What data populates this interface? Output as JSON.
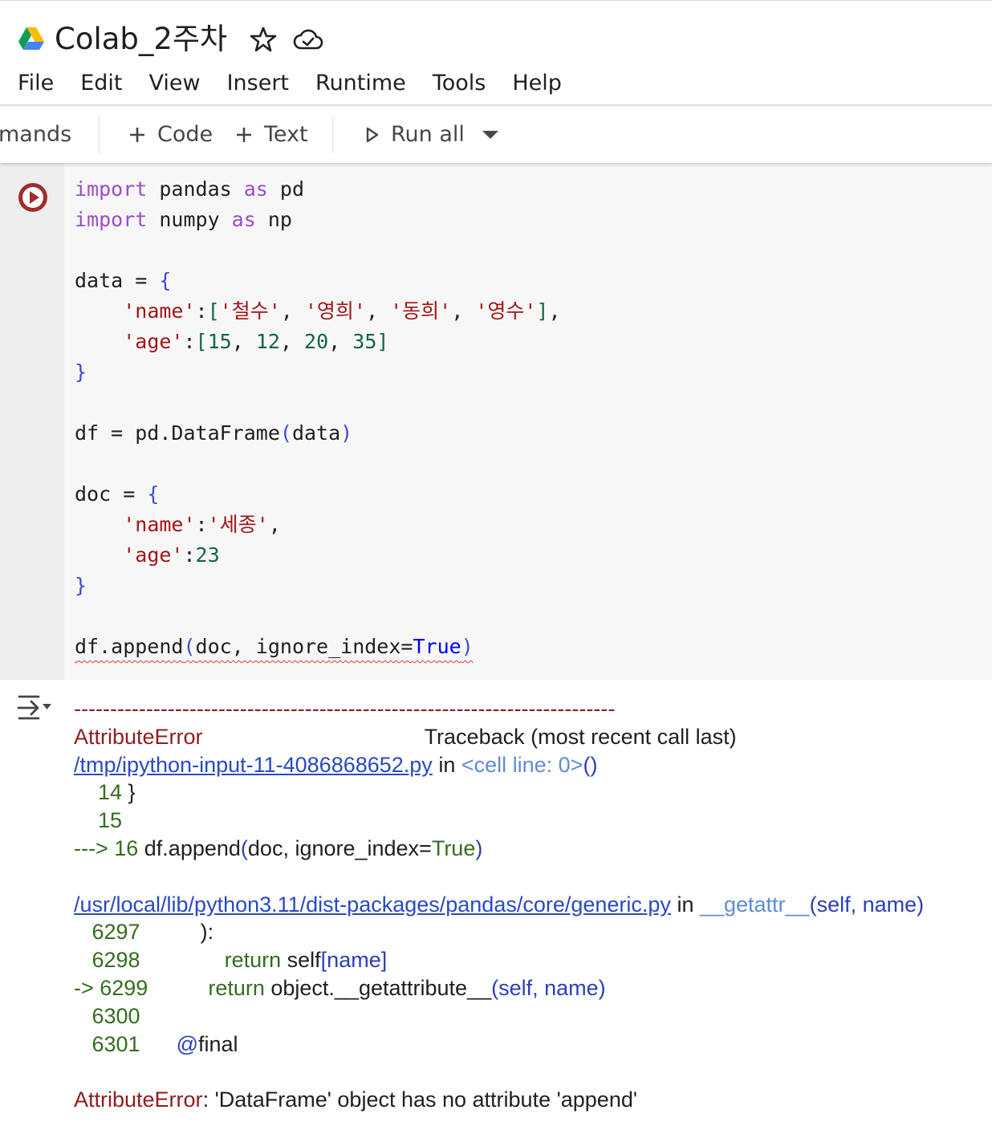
{
  "header": {
    "title": "Colab_2주차",
    "menu": [
      "File",
      "Edit",
      "View",
      "Insert",
      "Runtime",
      "Tools",
      "Help"
    ]
  },
  "toolbar": {
    "commands_label": "mands",
    "code_label": "Code",
    "text_label": "Text",
    "run_all_label": "Run all"
  },
  "cell": {
    "code": {
      "l1_kw1": "import",
      "l1_mod": " pandas ",
      "l1_kw2": "as",
      "l1_alias": " pd",
      "l2_kw1": "import",
      "l2_mod": " numpy ",
      "l2_kw2": "as",
      "l2_alias": " np",
      "l4_a": "data = ",
      "open": "{",
      "close": "}",
      "l5_indent": "    ",
      "name_key": "'name'",
      "colon": ":",
      "lbr": "[",
      "s1": "'철수'",
      "s2": "'영희'",
      "s3": "'동희'",
      "s4": "'영수'",
      "comma": ", ",
      "rbr": "]",
      "tail_comma": ",",
      "age_key": "'age'",
      "n1": "15",
      "n2": "12",
      "n3": "20",
      "n4": "35",
      "l10_a": "df = pd.DataFrame",
      "lp": "(",
      "l10_arg": "data",
      "rp": ")",
      "l12_a": "doc = ",
      "doc_name": "'세종'",
      "doc_age": "23",
      "l17_a": "df.append",
      "l17_arg": "doc, ignore_index=",
      "true_kw": "True"
    }
  },
  "output": {
    "dashes": "---------------------------------------------------------------------------",
    "err_name": "AttributeError",
    "traceback_label": "Traceback (most recent call last)",
    "file1": "/tmp/ipython-input-11-4086868652.py",
    "in_word": " in ",
    "loc1": "<cell line: 0>",
    "loc1_parens": "()",
    "t1_num": "    14",
    "t1_code": " }",
    "t2_num": "    15",
    "t3_arrow": "---> 16",
    "t3_code_a": " df.append",
    "t3_lp": "(",
    "t3_code_b": "doc, ignore_index=",
    "t3_true": "True",
    "t3_rp": ")",
    "file2": "/usr/local/lib/python3.11/dist-packages/pandas/core/generic.py",
    "func2": "__getattr__",
    "func2_args": "(self, name)",
    "f1_num": "   6297",
    "f1_code": "          ):",
    "f2_num": "   6298",
    "f2_kw": "              return",
    "f2_code": " self",
    "f2_idx": "[name]",
    "f3_arrow": "-> 6299",
    "f3_kw": "          return",
    "f3_code": " object.__getattribute__",
    "f3_args": "(self, name)",
    "f4_num": "   6300",
    "f5_num": "   6301",
    "f5_deco": "      @",
    "f5_code": "final",
    "final_err": "AttributeError",
    "final_msg": ": 'DataFrame' object has no attribute 'append'"
  }
}
